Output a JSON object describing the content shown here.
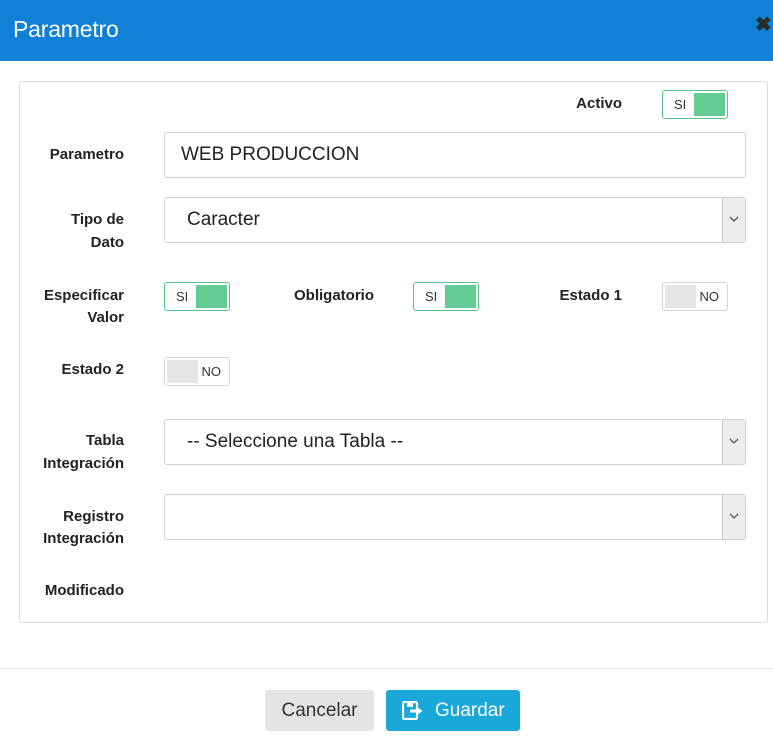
{
  "dialog": {
    "title": "Parametro",
    "close_glyph": "✖"
  },
  "form": {
    "activo": {
      "label": "Activo",
      "toggle_text": "SI",
      "on": true
    },
    "parametro": {
      "label": "Parametro",
      "value": "WEB PRODUCCION"
    },
    "tipo_dato": {
      "label_line1": "Tipo de",
      "label_line2": "Dato",
      "value": "Caracter"
    },
    "especificar_valor": {
      "label_line1": "Especificar",
      "label_line2": "Valor",
      "toggle_text": "SI",
      "on": true
    },
    "obligatorio": {
      "label": "Obligatorio",
      "toggle_text": "SI",
      "on": true
    },
    "estado1": {
      "label": "Estado 1",
      "toggle_text": "NO",
      "on": false
    },
    "estado2": {
      "label": "Estado 2",
      "toggle_text": "NO",
      "on": false
    },
    "tabla_integracion": {
      "label_line1": "Tabla",
      "label_line2": "Integración",
      "value": "-- Seleccione una Tabla --"
    },
    "registro_integracion": {
      "label_line1": "Registro",
      "label_line2": "Integración",
      "value": ""
    },
    "modificado": {
      "label": "Modificado"
    }
  },
  "footer": {
    "cancel_label": "Cancelar",
    "save_label": "Guardar"
  },
  "colors": {
    "header": "#1081d6",
    "toggle_on": "#63cc93",
    "save_button": "#1aa8d9"
  }
}
